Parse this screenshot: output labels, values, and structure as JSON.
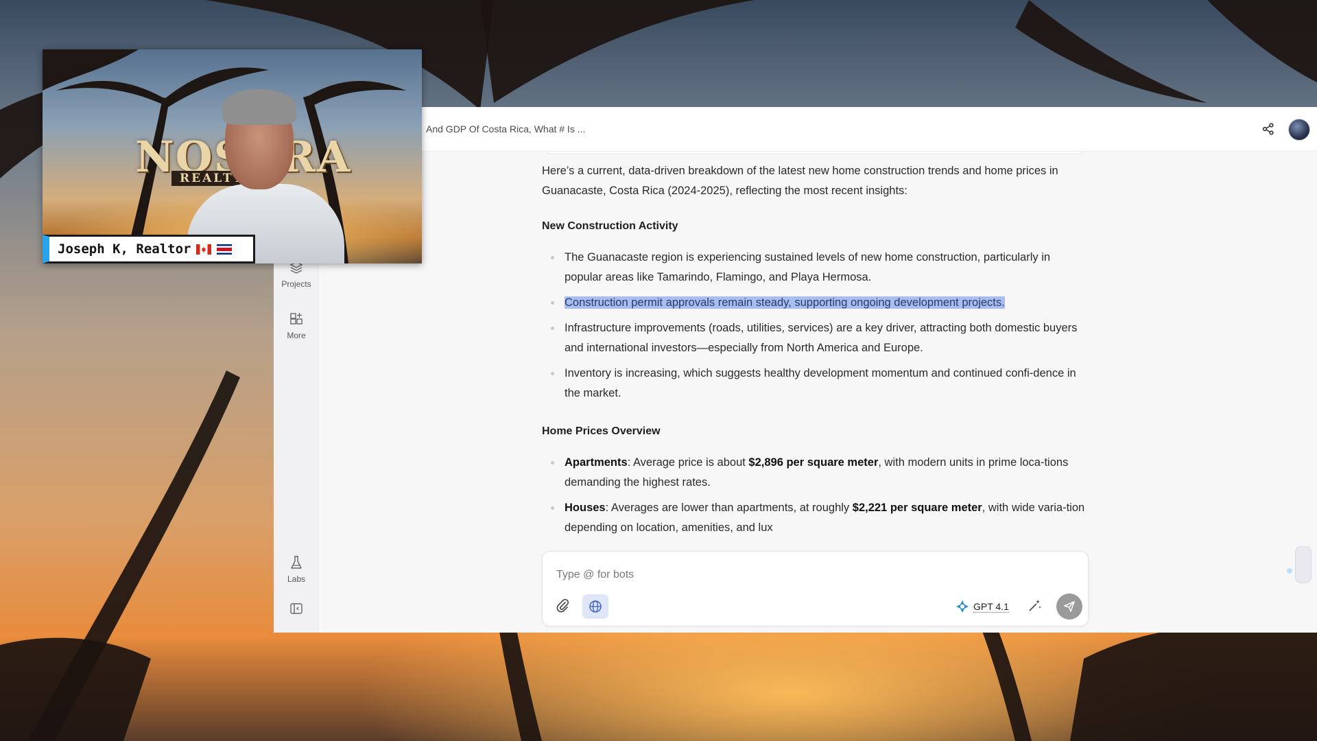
{
  "window": {
    "chat_title": "And GDP Of Costa Rica, What # Is ..."
  },
  "sidebar": {
    "items": [
      {
        "label": "Projects",
        "icon": "layers-icon"
      },
      {
        "label": "More",
        "icon": "grid-plus-icon"
      },
      {
        "label": "Labs",
        "icon": "flask-icon"
      }
    ],
    "collapse_icon": "sidebar-toggle-icon"
  },
  "message": {
    "intro": "Here’s a current, data-driven breakdown of the latest new home construction trends and home prices in Guanacaste, Costa Rica (2024-2025), reflecting the most recent insights:",
    "sections": [
      {
        "heading": "New Construction Activity",
        "bullets": [
          "The Guanacaste region is experiencing sustained levels of new home construction, particularly in popular areas like Tamarindo, Flamingo, and Playa Hermosa.",
          "Construction permit approvals remain steady, supporting ongoing development projects.",
          "Infrastructure improvements (roads, utilities, services) are a key driver, attracting both domestic buyers and international investors—especially from North America and Europe.",
          "Inventory is increasing, which suggests healthy development momentum and continued confi-dence in the market."
        ]
      },
      {
        "heading": "Home Prices Overview",
        "bullets": [
          {
            "bold": "Apartments",
            "text1": ": Average price is about ",
            "bold2": "$2,896 per square meter",
            "text2": ", with modern units in prime loca-tions demanding the highest rates."
          },
          {
            "bold": "Houses",
            "text1": ": Averages are lower than apartments, at roughly ",
            "bold2": "$2,221 per square meter",
            "text2": ", with wide varia-tion depending on location, amenities, and lux"
          }
        ]
      }
    ]
  },
  "composer": {
    "placeholder": "Type @ for bots",
    "model_label": "GPT 4.1"
  },
  "webcam": {
    "logo_text": "NOSARA",
    "logo_sub": "REALTY",
    "name_label": "Joseph K, Realtor"
  },
  "colors": {
    "highlight": "#a9bef0",
    "web_toggle_bg": "#dfe6f7",
    "send_button": "#9a9a9a",
    "nameplate_accent": "#2aa3ea"
  }
}
